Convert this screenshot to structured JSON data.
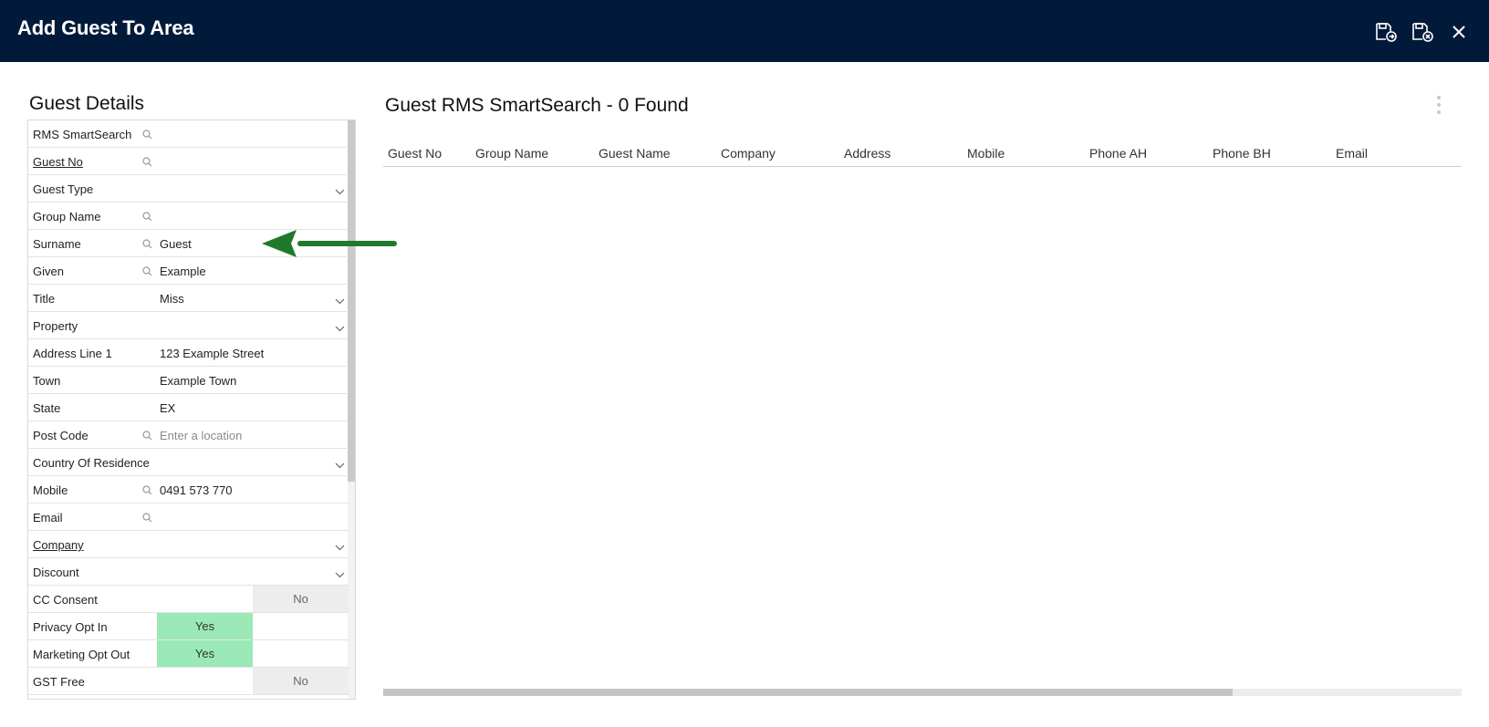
{
  "header": {
    "title": "Add Guest To Area",
    "icons": [
      "save-and-go-icon",
      "save-and-close-icon",
      "close-icon"
    ]
  },
  "guest_details": {
    "title": "Guest Details",
    "fields": [
      {
        "label": "RMS SmartSearch",
        "search": true,
        "value": "",
        "placeholder": "",
        "dropdown": false,
        "link": false
      },
      {
        "label": "Guest No",
        "search": true,
        "value": "",
        "placeholder": "",
        "dropdown": false,
        "link": true
      },
      {
        "label": "Guest Type",
        "search": false,
        "value": "",
        "placeholder": "",
        "dropdown": true,
        "link": false
      },
      {
        "label": "Group Name",
        "search": true,
        "value": "",
        "placeholder": "",
        "dropdown": false,
        "link": false
      },
      {
        "label": "Surname",
        "search": true,
        "value": "Guest",
        "placeholder": "",
        "dropdown": false,
        "link": false
      },
      {
        "label": "Given",
        "search": true,
        "value": "Example",
        "placeholder": "",
        "dropdown": false,
        "link": false
      },
      {
        "label": "Title",
        "search": false,
        "value": "Miss",
        "placeholder": "",
        "dropdown": true,
        "link": false
      },
      {
        "label": "Property",
        "search": false,
        "value": "",
        "placeholder": "",
        "dropdown": true,
        "link": false
      },
      {
        "label": "Address Line 1",
        "search": false,
        "value": "123 Example Street",
        "placeholder": "",
        "dropdown": false,
        "link": false
      },
      {
        "label": "Town",
        "search": false,
        "value": "Example Town",
        "placeholder": "",
        "dropdown": false,
        "link": false
      },
      {
        "label": "State",
        "search": false,
        "value": "EX",
        "placeholder": "",
        "dropdown": false,
        "link": false
      },
      {
        "label": "Post Code",
        "search": true,
        "value": "",
        "placeholder": "Enter a location",
        "dropdown": false,
        "link": false
      },
      {
        "label": "Country Of Residence",
        "search": false,
        "value": "",
        "placeholder": "",
        "dropdown": true,
        "link": false
      },
      {
        "label": "Mobile",
        "search": true,
        "value": "0491 573 770",
        "placeholder": "",
        "dropdown": false,
        "link": false
      },
      {
        "label": "Email",
        "search": true,
        "value": "",
        "placeholder": "",
        "dropdown": false,
        "link": false
      },
      {
        "label": "Company",
        "search": false,
        "value": "",
        "placeholder": "",
        "dropdown": true,
        "link": true
      },
      {
        "label": "Discount",
        "search": false,
        "value": "",
        "placeholder": "",
        "dropdown": true,
        "link": false
      }
    ],
    "toggles": [
      {
        "label": "CC Consent",
        "yes_label": "",
        "no_label": "No",
        "state": "no"
      },
      {
        "label": "Privacy Opt In",
        "yes_label": "Yes",
        "no_label": "",
        "state": "yes"
      },
      {
        "label": "Marketing Opt Out",
        "yes_label": "Yes",
        "no_label": "",
        "state": "yes"
      },
      {
        "label": "GST Free",
        "yes_label": "",
        "no_label": "No",
        "state": "no"
      }
    ]
  },
  "results": {
    "title": "Guest RMS SmartSearch - 0 Found",
    "columns": [
      "Guest No",
      "Group Name",
      "Guest Name",
      "Company",
      "Address",
      "Mobile",
      "Phone AH",
      "Phone BH",
      "Email"
    ]
  },
  "colors": {
    "header_bg": "#021a3a",
    "toggle_yes": "#9ae9b6",
    "toggle_no": "#ededed",
    "arrow": "#1e7a2a"
  }
}
